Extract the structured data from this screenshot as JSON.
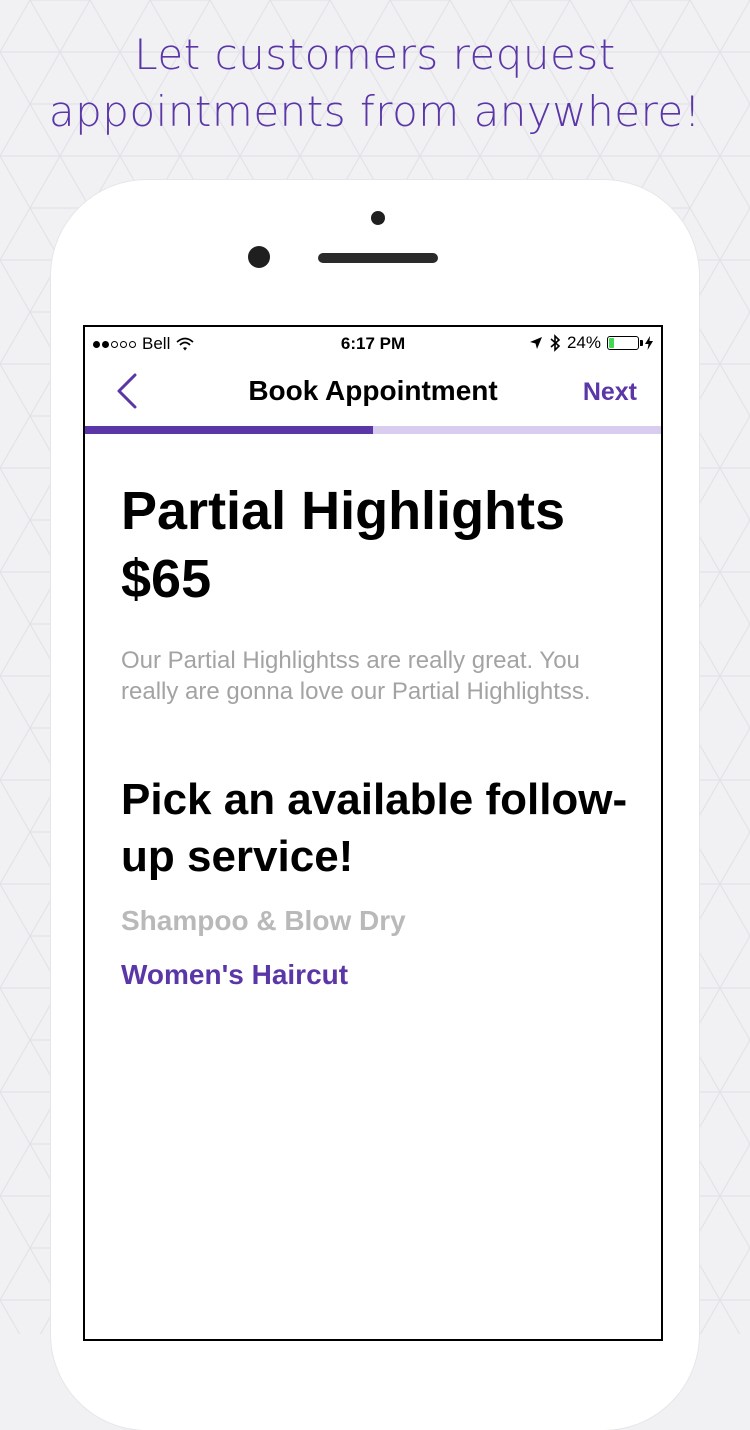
{
  "promo": {
    "line1": "Let customers request",
    "line2": "appointments from anywhere!"
  },
  "status_bar": {
    "carrier": "Bell",
    "time": "6:17 PM",
    "battery_percent": "24%",
    "battery_level": 0.24,
    "signal_bars_filled": 2,
    "signal_bars_total": 5
  },
  "navbar": {
    "title": "Book Appointment",
    "next_label": "Next"
  },
  "progress": {
    "fraction": 0.5
  },
  "service": {
    "name": "Partial Highlights",
    "price": "$65",
    "description": "Our Partial Highlightss are really great. You really are gonna love our Partial Highlightss."
  },
  "follow_up": {
    "heading": "Pick an available follow-up service!",
    "options": [
      {
        "label": "Shampoo & Blow Dry",
        "available": false
      },
      {
        "label": "Women's Haircut",
        "available": true
      }
    ]
  },
  "colors": {
    "accent": "#5b36a7",
    "progress_track": "#d8cdee",
    "disabled_text": "#b9b9b9",
    "description_text": "#a3a3a3",
    "background": "#f1f1f4"
  }
}
